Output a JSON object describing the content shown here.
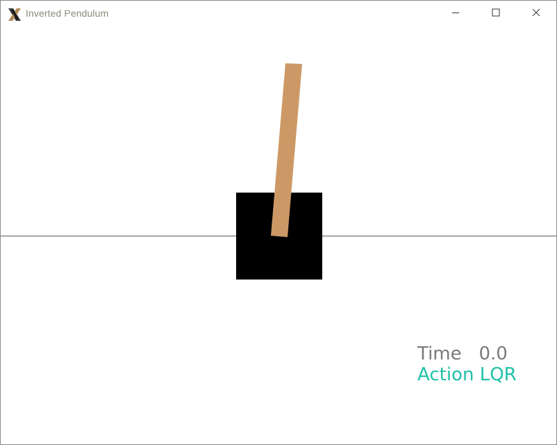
{
  "window": {
    "title": "Inverted Pendulum",
    "icon": "x-app-icon",
    "controls": [
      "minimize-icon",
      "maximize-icon",
      "close-icon"
    ]
  },
  "simulation": {
    "track_color": "#a0a0a0",
    "cart_color": "#000000",
    "pole_color": "#cc9966"
  },
  "hud": {
    "time_label": "Time",
    "time_value": "0.0",
    "time_color": "#7a7a7a",
    "action_label": "Action",
    "action_value": "LQR",
    "action_color": "#20c0a8"
  }
}
